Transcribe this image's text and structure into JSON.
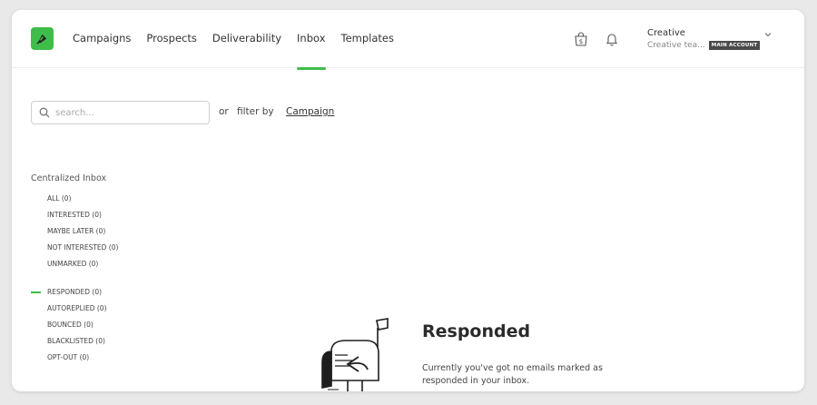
{
  "nav": {
    "items": [
      {
        "label": "Campaigns",
        "active": false
      },
      {
        "label": "Prospects",
        "active": false
      },
      {
        "label": "Deliverability",
        "active": false
      },
      {
        "label": "Inbox",
        "active": true
      },
      {
        "label": "Templates",
        "active": false
      }
    ]
  },
  "header": {
    "icons": [
      "shopping-bag-dollar-icon",
      "bell-icon"
    ],
    "account": {
      "name": "Creative",
      "team": "Creative tea...",
      "badge": "MAIN ACCOUNT"
    }
  },
  "search": {
    "placeholder": "search...",
    "value": "",
    "or_label": "or",
    "filter_label": "filter by",
    "campaign_link": "Campaign"
  },
  "sidebar": {
    "title": "Centralized Inbox",
    "group1": [
      {
        "label": "ALL (0)"
      },
      {
        "label": "INTERESTED (0)"
      },
      {
        "label": "MAYBE LATER (0)"
      },
      {
        "label": "NOT INTERESTED (0)"
      },
      {
        "label": "UNMARKED (0)"
      }
    ],
    "group2": [
      {
        "label": "RESPONDED (0)",
        "active": true
      },
      {
        "label": "AUTOREPLIED (0)"
      },
      {
        "label": "BOUNCED (0)"
      },
      {
        "label": "BLACKLISTED (0)"
      },
      {
        "label": "OPT-OUT (0)"
      }
    ]
  },
  "empty_state": {
    "title": "Responded",
    "description": "Currently you've got no emails marked as responded in your inbox."
  },
  "colors": {
    "accent": "#3fbd4b",
    "badge_bg": "#4a4a4a",
    "background": "#e9e9ea"
  }
}
